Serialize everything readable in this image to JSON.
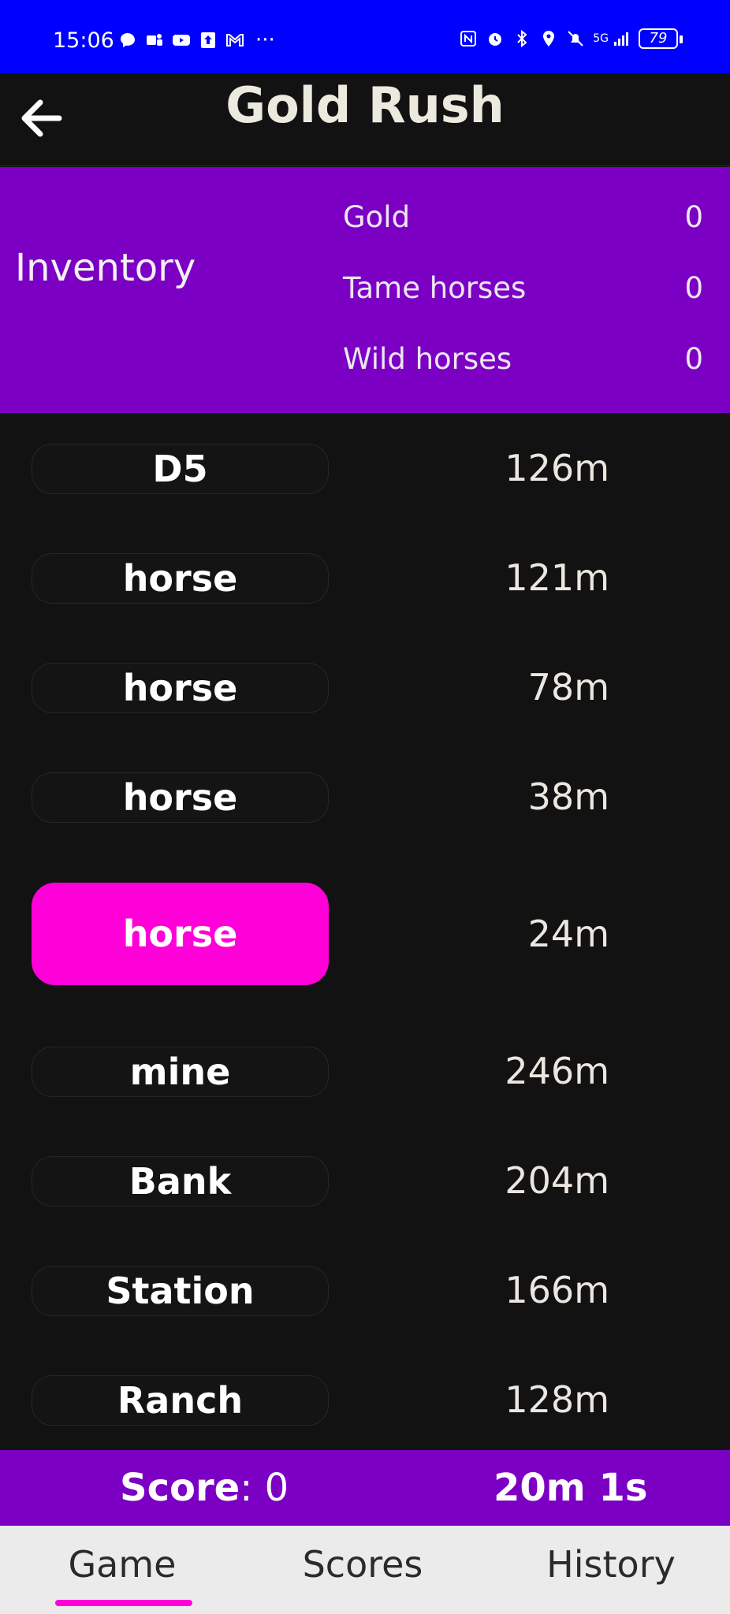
{
  "status_bar": {
    "time": "15:06",
    "overflow": "···",
    "battery": "79",
    "network": "5G",
    "left_icons": [
      "chat-icon",
      "teams-icon",
      "youtube-icon",
      "upload-icon",
      "gmail-icon"
    ],
    "right_icons": [
      "nfc-icon",
      "alarm-icon",
      "bluetooth-icon",
      "location-icon",
      "mute-icon",
      "signal-icon"
    ]
  },
  "header": {
    "title": "Gold Rush",
    "back_icon": "arrow-left-icon"
  },
  "inventory": {
    "label": "Inventory",
    "rows": [
      {
        "name": "Gold",
        "value": "0"
      },
      {
        "name": "Tame horses",
        "value": "0"
      },
      {
        "name": "Wild horses",
        "value": "0"
      }
    ]
  },
  "items": [
    {
      "name": "D5",
      "distance": "126m",
      "active": false
    },
    {
      "name": "horse",
      "distance": "121m",
      "active": false
    },
    {
      "name": "horse",
      "distance": "78m",
      "active": false
    },
    {
      "name": "horse",
      "distance": "38m",
      "active": false
    },
    {
      "name": "horse",
      "distance": "24m",
      "active": true
    },
    {
      "name": "mine",
      "distance": "246m",
      "active": false
    },
    {
      "name": "Bank",
      "distance": "204m",
      "active": false
    },
    {
      "name": "Station",
      "distance": "166m",
      "active": false
    },
    {
      "name": "Ranch",
      "distance": "128m",
      "active": false
    }
  ],
  "score_bar": {
    "score_label": "Score",
    "score_sep": ":",
    "score_value": "0",
    "timer": "20m 1s"
  },
  "nav": {
    "tabs": [
      {
        "label": "Game",
        "selected": true
      },
      {
        "label": "Scores",
        "selected": false
      },
      {
        "label": "History",
        "selected": false
      }
    ]
  },
  "colors": {
    "status_bar": "#0000ff",
    "accent_purple": "#7b00c4",
    "accent_pink": "#ff00d9",
    "background": "#121212"
  }
}
